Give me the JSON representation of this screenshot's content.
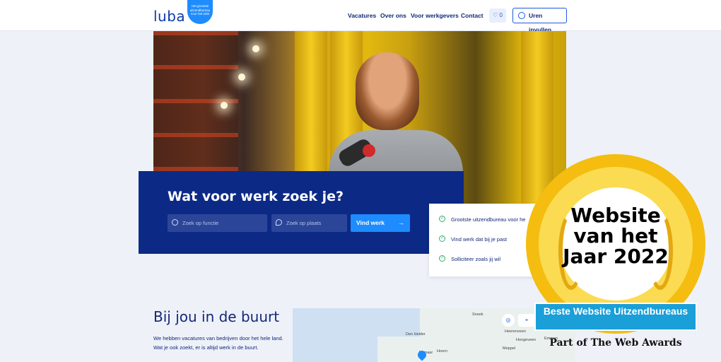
{
  "header": {
    "logo": "luba",
    "badge_text": "Het grootste uitzendbureau voor het mkb",
    "nav": [
      "Vacatures",
      "Over ons",
      "Voor werkgevers",
      "Contact"
    ],
    "favorites_count": "0",
    "hours_button": "Uren invullen"
  },
  "hero": {
    "search_title": "Wat voor werk zoek je?",
    "function_placeholder": "Zoek op functie",
    "location_placeholder": "Zoek op plaats",
    "search_button": "Vind werk",
    "checks": [
      "Grootste uitzendbureau voor he",
      "Vind werk dat bij je past",
      "Solliciteer zoals jij wil"
    ]
  },
  "nearby": {
    "title": "Bij jou in de buurt",
    "text": "We hebben vacatures van bedrijven door het hele land. Wat je ook zoekt, er is altijd werk in de buurt.",
    "map_labels": [
      "Sneek",
      "Heerenveen",
      "Emmen",
      "Meppel",
      "Hoogeveen",
      "Den Helder",
      "Alkmaar",
      "Hoorn"
    ]
  },
  "award": {
    "title": "Website van het Jaar 2022",
    "ribbon": "Beste Website Uitzendbureaus",
    "footer": "Part of The Web Awards"
  },
  "colors": {
    "brand": "#0c2a85",
    "accent": "#1e8cff",
    "award_gold": "#f4bd10"
  }
}
